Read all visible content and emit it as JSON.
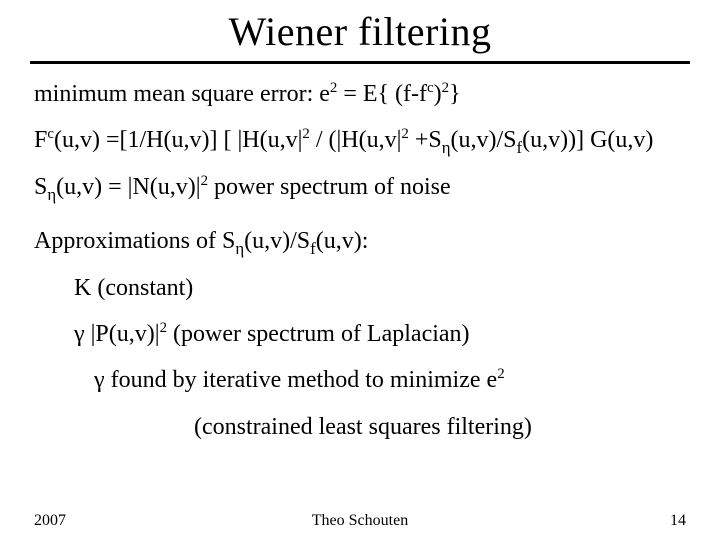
{
  "title": "Wiener filtering",
  "lines": {
    "mse_label": "minimum mean square error: e",
    "mse_eq_a": " = E{ (f-f",
    "mse_eq_b": ")",
    "mse_eq_c": "}",
    "fc_a": "F",
    "fc_b": "(u,v) =[1/H(u,v)] [ |H(u,v|",
    "fc_c": " / (|H(u,v|",
    "fc_d": " +S",
    "fc_e": "(u,v)/S",
    "fc_f": "(u,v))] G(u,v)",
    "sn_a": "S",
    "sn_b": "(u,v) = |N(u,v)|",
    "sn_c": " power spectrum of noise",
    "approx_a": "Approximations of S",
    "approx_b": "(u,v)/S",
    "approx_c": "(u,v):",
    "k_label": "K (constant)",
    "gp_a": " |P(u,v)|",
    "gp_b": "  (power spectrum of Laplacian)",
    "iter_a": " found by iterative method to minimize e",
    "cls": "(constrained least squares filtering)"
  },
  "sym": {
    "eta": "η",
    "gamma": "γ",
    "f": "f",
    "c": "c",
    "two": "2"
  },
  "footer": {
    "year": "2007",
    "author": "Theo Schouten",
    "page": "14"
  }
}
